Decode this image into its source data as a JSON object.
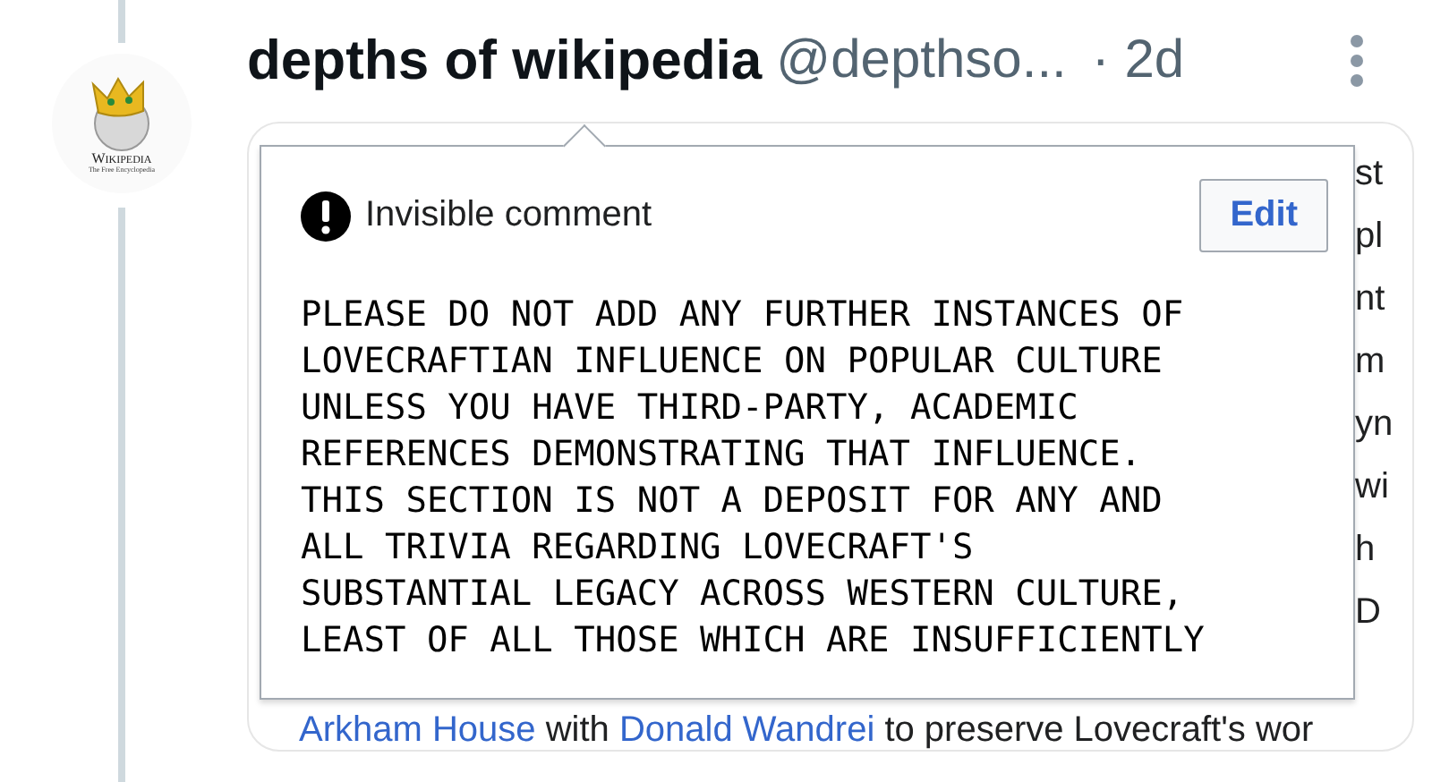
{
  "avatar": {
    "wordmark": "Wikipedia",
    "tagline": "The Free Encyclopedia"
  },
  "post": {
    "name": "depths of wikipedia",
    "handle": "@depthso...",
    "time": "· 2d"
  },
  "popup": {
    "title": "Invisible comment",
    "edit_button": "Edit",
    "lines": [
      "PLEASE DO NOT ADD ANY FURTHER INSTANCES OF",
      "LOVECRAFTIAN INFLUENCE ON POPULAR CULTURE",
      "UNLESS YOU HAVE THIRD-PARTY, ACADEMIC",
      "REFERENCES DEMONSTRATING THAT INFLUENCE.",
      "THIS SECTION IS NOT A DEPOSIT FOR ANY AND",
      "ALL TRIVIA REGARDING LOVECRAFT'S",
      "SUBSTANTIAL LEGACY ACROSS WESTERN CULTURE,",
      "LEAST OF ALL THOSE WHICH ARE INSUFFICIENTLY"
    ]
  },
  "article_edge": [
    "st",
    "pl",
    "nt",
    "m",
    "yn",
    "wi",
    "h",
    "D"
  ],
  "article_last_line": [
    {
      "text": "Arkham House",
      "kind": "link"
    },
    {
      "text": " with ",
      "kind": "plain"
    },
    {
      "text": "Donald Wandrei",
      "kind": "link"
    },
    {
      "text": " to preserve Lovecraft's wor",
      "kind": "plain"
    }
  ]
}
